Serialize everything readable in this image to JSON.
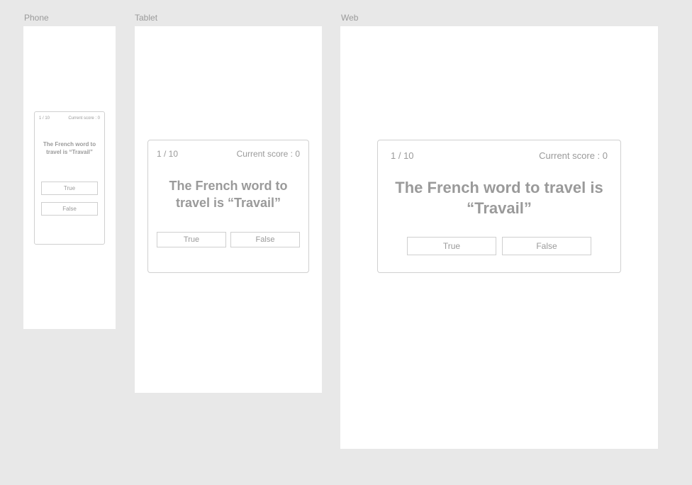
{
  "labels": {
    "phone": "Phone",
    "tablet": "Tablet",
    "web": "Web"
  },
  "progress": "1 / 10",
  "score_label": "Current score : 0",
  "question": "The French word to travel is “Travail”",
  "buttons": {
    "true": "True",
    "false": "False"
  }
}
